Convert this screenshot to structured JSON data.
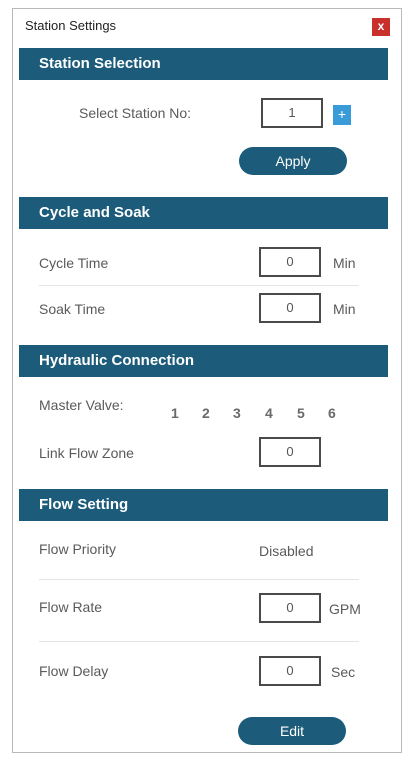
{
  "window": {
    "title": "Station Settings",
    "close_label": "x"
  },
  "station_selection": {
    "header": "Station Selection",
    "select_label": "Select Station No:",
    "station_value": "1",
    "plus_label": "+",
    "apply_label": "Apply"
  },
  "cycle_soak": {
    "header": "Cycle and Soak",
    "cycle_label": "Cycle Time",
    "cycle_value": "0",
    "cycle_unit": "Min",
    "soak_label": "Soak Time",
    "soak_value": "0",
    "soak_unit": "Min"
  },
  "hydraulic": {
    "header": "Hydraulic Connection",
    "master_valve_label": "Master Valve:",
    "master_valves": [
      "1",
      "2",
      "3",
      "4",
      "5",
      "6"
    ],
    "link_flow_label": "Link Flow Zone",
    "link_flow_value": "0"
  },
  "flow_setting": {
    "header": "Flow Setting",
    "priority_label": "Flow Priority",
    "priority_value": "Disabled",
    "rate_label": "Flow Rate",
    "rate_value": "0",
    "rate_unit": "GPM",
    "delay_label": "Flow Delay",
    "delay_value": "0",
    "delay_unit": "Sec",
    "edit_label": "Edit"
  }
}
